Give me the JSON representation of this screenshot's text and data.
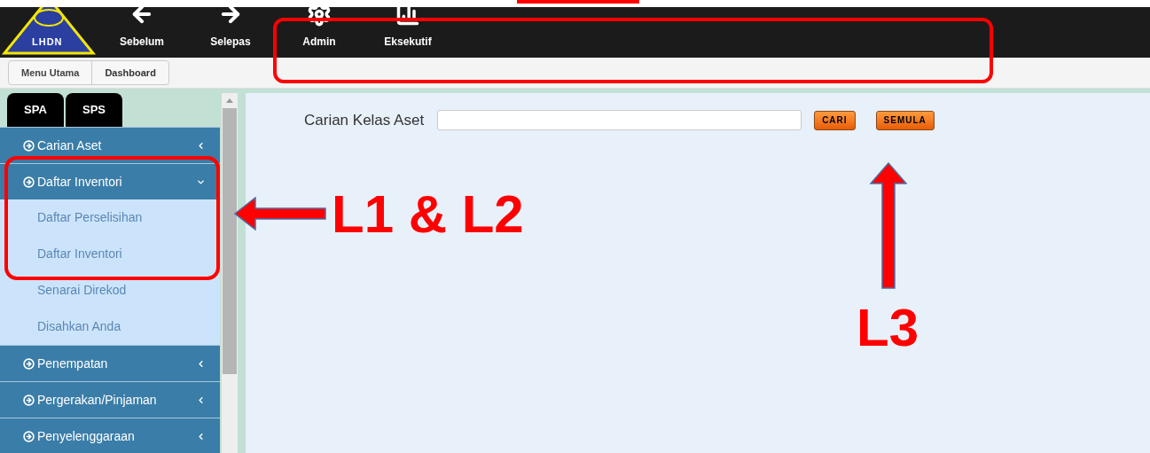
{
  "logo": {
    "text": "LHDN"
  },
  "nav": [
    {
      "label": "Sebelum",
      "kind": "back"
    },
    {
      "label": "Selepas",
      "kind": "forward"
    },
    {
      "label": "Admin",
      "kind": "admin"
    },
    {
      "label": "Eksekutif",
      "kind": "chart"
    }
  ],
  "breadcrumb": [
    "Menu Utama",
    "Dashboard"
  ],
  "sidebar": {
    "tabs": [
      "SPA",
      "SPS"
    ],
    "items": [
      {
        "label": "Carian Aset",
        "expanded": false
      },
      {
        "label": "Daftar Inventori",
        "expanded": true,
        "children": [
          "Daftar Perselisihan",
          "Daftar Inventori",
          "Senarai Direkod",
          "Disahkan Anda"
        ]
      },
      {
        "label": "Penempatan",
        "expanded": false
      },
      {
        "label": "Pergerakan/Pinjaman",
        "expanded": false
      },
      {
        "label": "Penyelenggaraan",
        "expanded": false
      }
    ]
  },
  "search": {
    "label": "Carian Kelas Aset",
    "buttons": [
      "CARI",
      "SEMULA"
    ]
  },
  "annotations": {
    "left_label": "L1 & L2",
    "right_label": "L3"
  }
}
